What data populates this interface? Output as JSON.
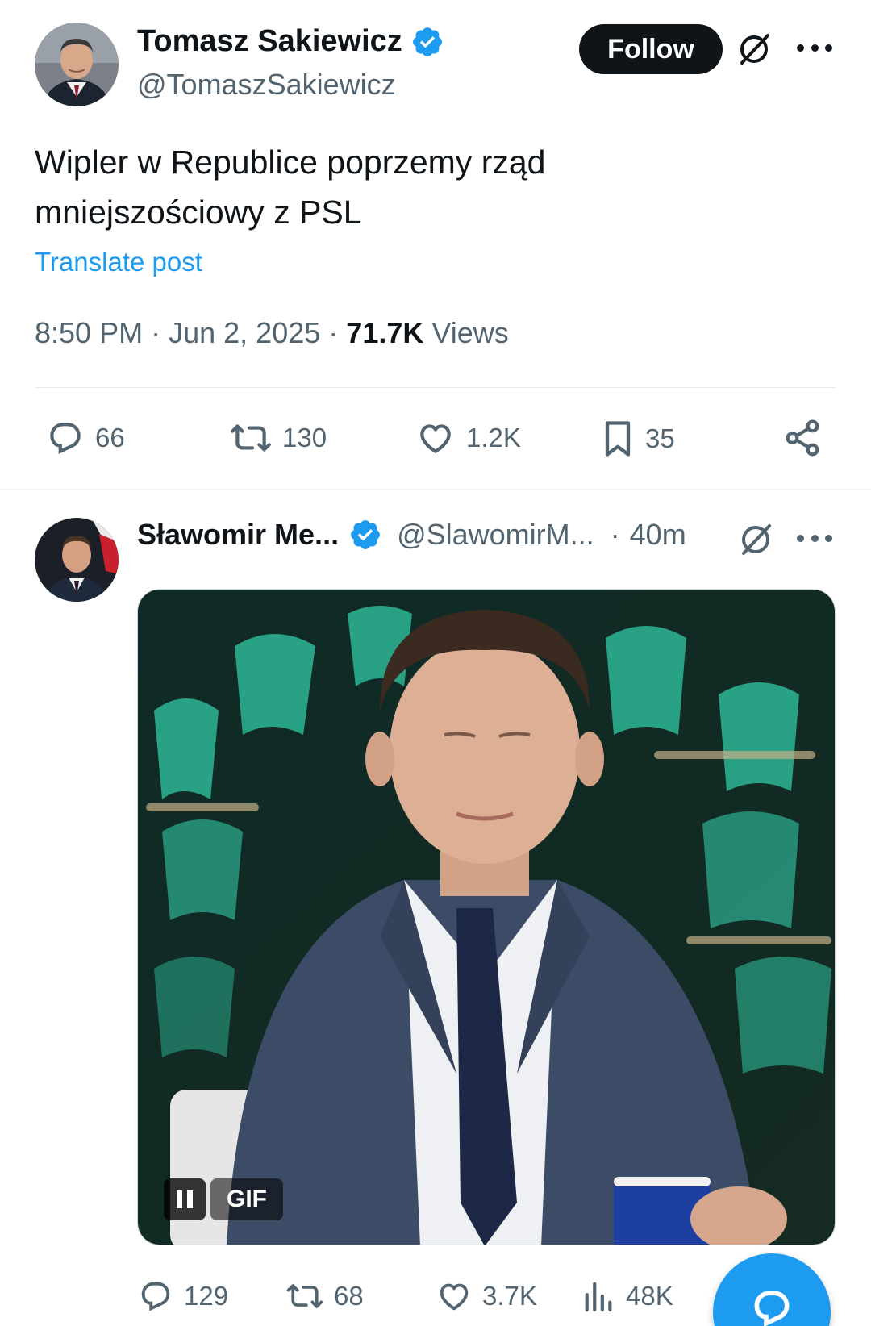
{
  "main_tweet": {
    "author": {
      "display_name": "Tomasz Sakiewicz",
      "handle": "@TomaszSakiewicz",
      "verified": true
    },
    "follow_label": "Follow",
    "text": "Wipler w Republice poprzemy rząd\nmniejszościowy z PSL",
    "translate_label": "Translate post",
    "time": "8:50 PM",
    "separator": "·",
    "date": "Jun 2, 2025",
    "views_count": "71.7K",
    "views_label": "Views",
    "actions": {
      "replies": "66",
      "reposts": "130",
      "likes": "1.2K",
      "bookmarks": "35"
    }
  },
  "reply_tweet": {
    "author": {
      "display_name": "Sławomir Me...",
      "handle": "@SlawomirM...",
      "verified": true
    },
    "separator": "·",
    "time": "40m",
    "media": {
      "type": "GIF",
      "badge_label": "GIF"
    },
    "actions": {
      "replies": "129",
      "reposts": "68",
      "likes": "3.7K",
      "views": "48K"
    }
  },
  "icons": {
    "verified": "verified-badge-icon",
    "grok": "grok-icon",
    "more": "more-options-icon",
    "reply": "reply-icon",
    "repost": "repost-icon",
    "like": "like-icon",
    "bookmark": "bookmark-icon",
    "share": "share-icon",
    "views": "views-icon",
    "compose": "compose-icon"
  },
  "colors": {
    "accent": "#1d9bf0",
    "text_primary": "#0f1419",
    "text_secondary": "#536471",
    "follow_button_bg": "#0f1419"
  }
}
